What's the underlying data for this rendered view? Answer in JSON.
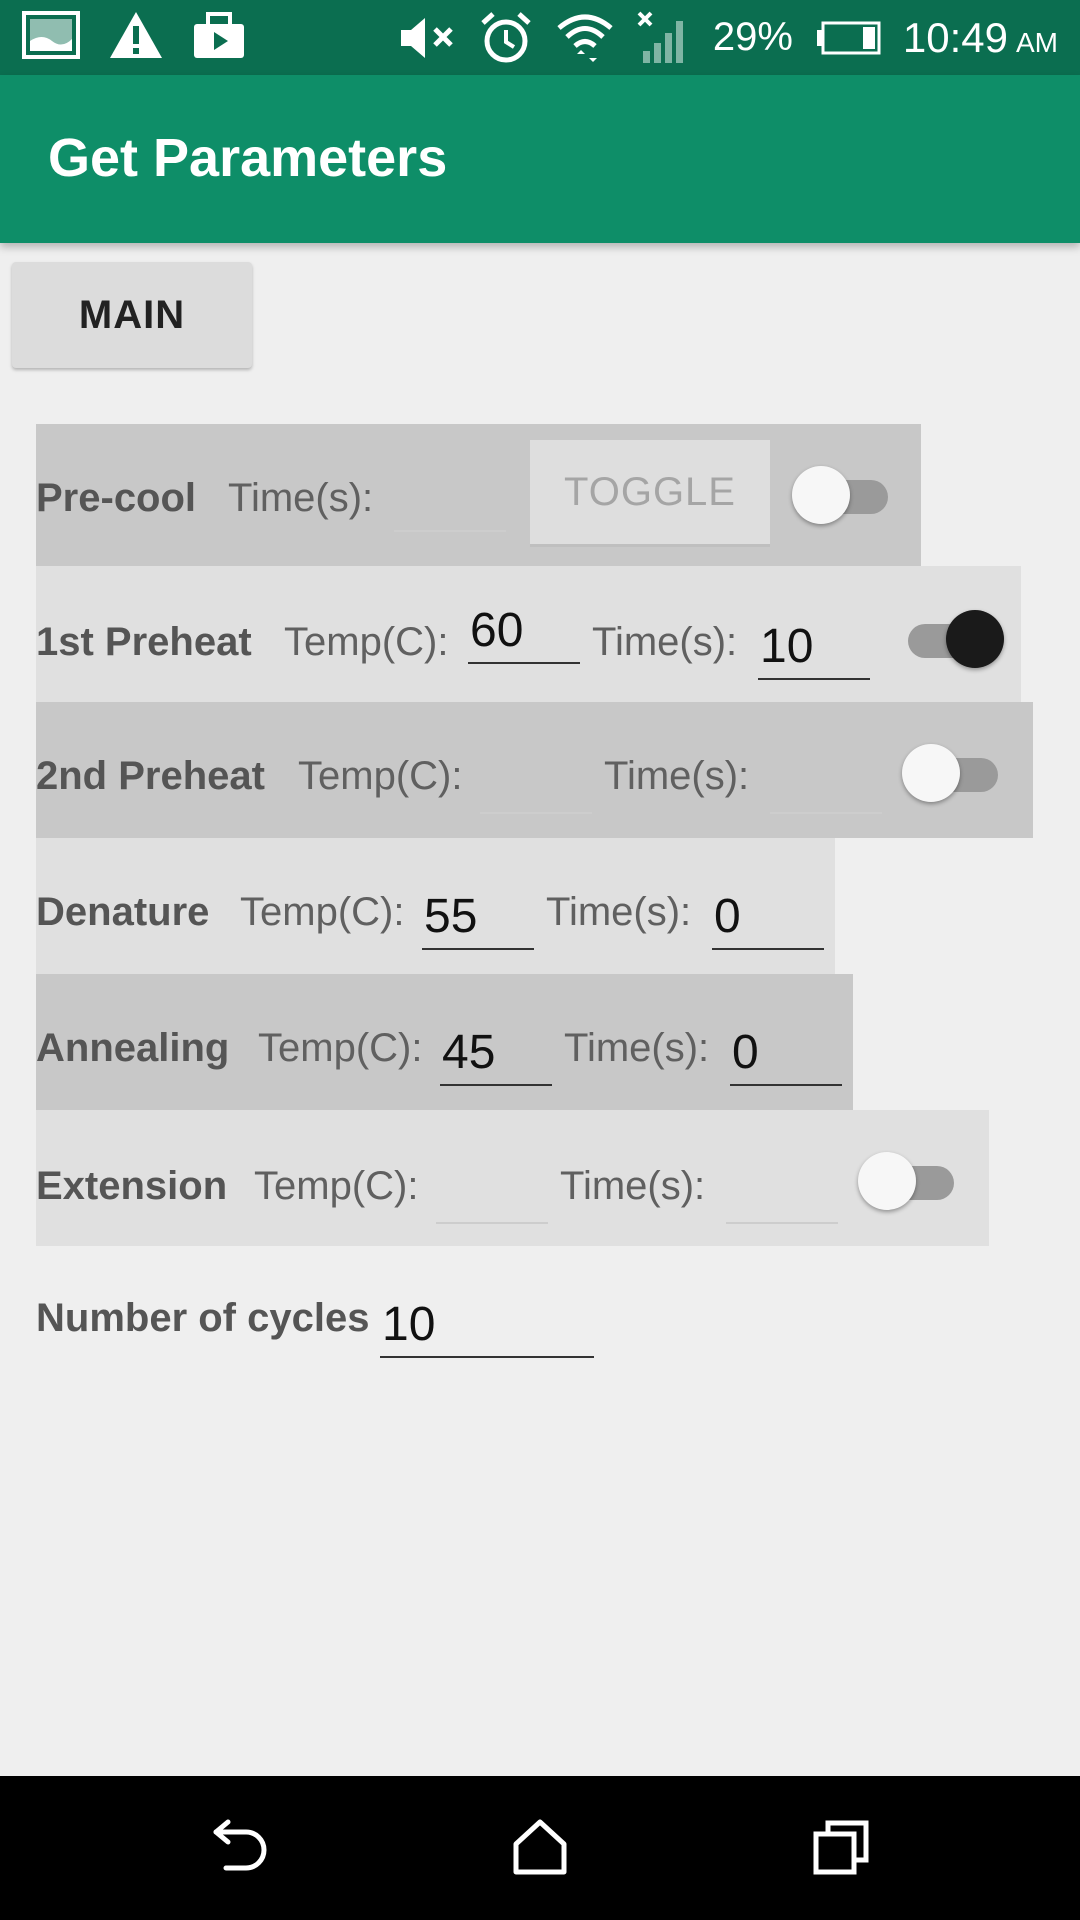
{
  "status_bar": {
    "battery": "29%",
    "time": "10:49",
    "ampm": "AM",
    "icons": [
      "gallery-icon",
      "warning-icon",
      "work-briefcase-icon",
      "mute-icon",
      "alarm-icon",
      "wifi-icon",
      "no-signal-icon",
      "battery-icon"
    ]
  },
  "app_bar": {
    "title": "Get Parameters"
  },
  "main_button": {
    "label": "MAIN"
  },
  "rows": {
    "precool": {
      "name": "Pre-cool",
      "time_label": "Time(s):",
      "time_value": "",
      "toggle_button": "TOGGLE",
      "switch_on": false
    },
    "preheat1": {
      "name": "1st Preheat",
      "temp_label": "Temp(C):",
      "temp_value": "60",
      "time_label": "Time(s):",
      "time_value": "10",
      "switch_on": true
    },
    "preheat2": {
      "name": "2nd Preheat",
      "temp_label": "Temp(C):",
      "temp_value": "",
      "time_label": "Time(s):",
      "time_value": "",
      "switch_on": false
    },
    "denature": {
      "name": "Denature",
      "temp_label": "Temp(C):",
      "temp_value": "55",
      "time_label": "Time(s):",
      "time_value": "0"
    },
    "annealing": {
      "name": "Annealing",
      "temp_label": "Temp(C):",
      "temp_value": "45",
      "time_label": "Time(s):",
      "time_value": "0"
    },
    "extension": {
      "name": "Extension",
      "temp_label": "Temp(C):",
      "temp_value": "",
      "time_label": "Time(s):",
      "time_value": "",
      "switch_on": false
    }
  },
  "cycles": {
    "label": "Number of cycles",
    "value": "10"
  },
  "nav_bar": {
    "icons": [
      "back-icon",
      "home-icon",
      "recents-icon"
    ]
  }
}
